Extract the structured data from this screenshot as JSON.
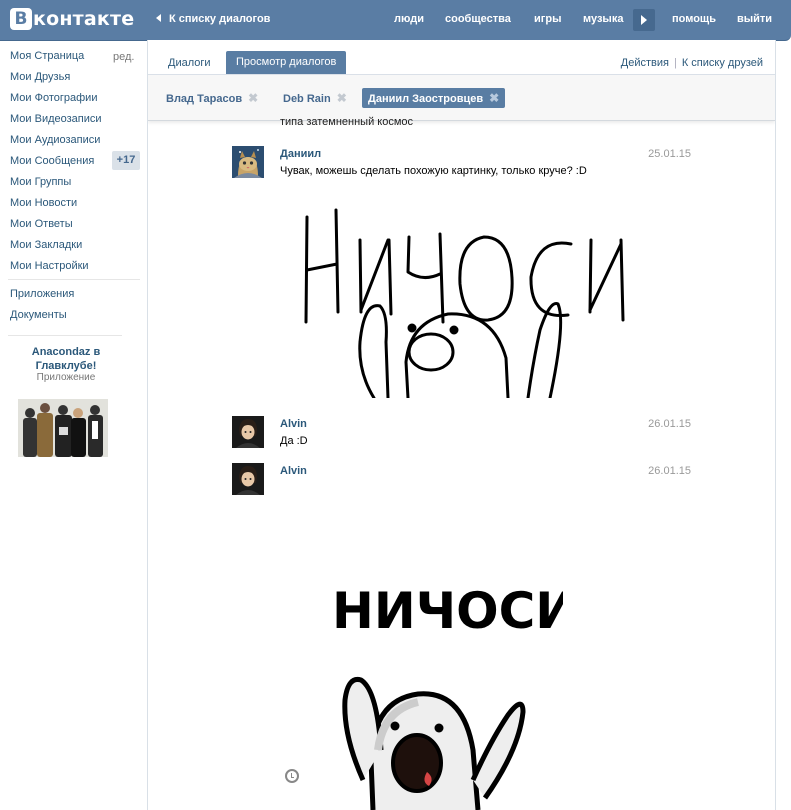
{
  "header": {
    "logo_letter": "В",
    "logo_text": "контакте",
    "back_link": "К списку диалогов",
    "nav": [
      "люди",
      "сообщества",
      "игры",
      "музыка",
      "помощь",
      "выйти"
    ]
  },
  "sidebar": {
    "items": [
      "Моя Страница",
      "Мои Друзья",
      "Мои Фотографии",
      "Мои Видеозаписи",
      "Мои Аудиозаписи",
      "Мои Сообщения",
      "Мои Группы",
      "Мои Новости",
      "Мои Ответы",
      "Мои Закладки",
      "Мои Настройки"
    ],
    "edit_label": "ред.",
    "messages_badge": "+17",
    "extra_items": [
      "Приложения",
      "Документы"
    ],
    "promo": {
      "title": "Anacondaz в Главклубе!",
      "subtitle": "Приложение"
    }
  },
  "tabs": {
    "dialogs": "Диалоги",
    "view": "Просмотр диалогов",
    "actions": "Действия",
    "to_friends": "К списку друзей"
  },
  "peers": [
    "Влад Тарасов",
    "Deb Rain",
    "Даниил Заостровцев"
  ],
  "messages": {
    "clipped_text": "типа затемненный космос",
    "items": [
      {
        "author": "Даниил",
        "date": "25.01.15",
        "text": "Чувак, можешь сделать похожую картинку, только круче? :D"
      },
      {
        "author": "Alvin",
        "date": "26.01.15",
        "text": "Да :D"
      },
      {
        "author": "Alvin",
        "date": "26.01.15",
        "text": ""
      }
    ],
    "doodle_text": "НИЧОСИ",
    "sticker_text": "НИЧОСИ"
  },
  "colors": {
    "brand_blue": "#5a7da4",
    "link_blue": "#2b587a",
    "active_tab": "#597da3"
  }
}
